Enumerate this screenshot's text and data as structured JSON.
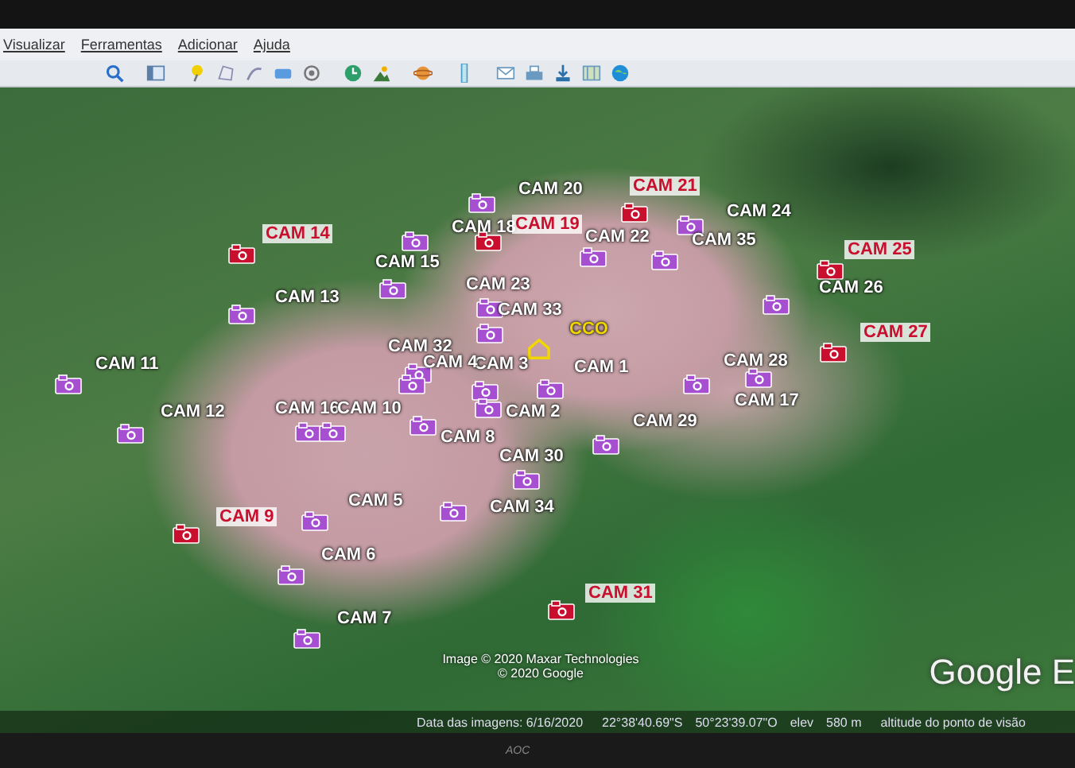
{
  "menu": [
    {
      "label": "Visualizar"
    },
    {
      "label": "Ferramentas"
    },
    {
      "label": "Adicionar"
    },
    {
      "label": "Ajuda"
    }
  ],
  "markers": [
    {
      "kind": "camera",
      "label": "CAM 20",
      "color": "#a64fd0"
    },
    {
      "kind": "camera",
      "label": "CAM 21",
      "color": "#c8102e"
    },
    {
      "kind": "camera",
      "label": "CAM 24",
      "color": "#a64fd0"
    },
    {
      "kind": "camera",
      "label": "CAM 14",
      "color": "#c8102e"
    },
    {
      "kind": "camera",
      "label": "CAM 18",
      "color": "#a64fd0"
    },
    {
      "kind": "camera",
      "label": "CAM 19",
      "color": "#c8102e"
    },
    {
      "kind": "camera",
      "label": "CAM 22",
      "color": "#a64fd0"
    },
    {
      "kind": "camera",
      "label": "CAM 35",
      "color": "#a64fd0"
    },
    {
      "kind": "camera",
      "label": "CAM 25",
      "color": "#c8102e"
    },
    {
      "kind": "camera",
      "label": "CAM 15",
      "color": "#a64fd0"
    },
    {
      "kind": "camera",
      "label": "CAM 23",
      "color": "#a64fd0"
    },
    {
      "kind": "camera",
      "label": "CAM 13",
      "color": "#a64fd0"
    },
    {
      "kind": "camera",
      "label": "CAM 26",
      "color": "#a64fd0"
    },
    {
      "kind": "camera",
      "label": "CAM 33",
      "color": "#a64fd0"
    },
    {
      "kind": "home",
      "label": "CCO",
      "color": "#f2d600"
    },
    {
      "kind": "camera",
      "label": "CAM 27",
      "color": "#c8102e"
    },
    {
      "kind": "camera",
      "label": "CAM 11",
      "color": "#a64fd0"
    },
    {
      "kind": "camera",
      "label": "CAM 32",
      "color": "#a64fd0"
    },
    {
      "kind": "camera",
      "label": "CAM 3",
      "color": "#a64fd0"
    },
    {
      "kind": "camera",
      "label": "CAM 1",
      "color": "#a64fd0"
    },
    {
      "kind": "camera",
      "label": "CAM 2",
      "color": "#a64fd0"
    },
    {
      "kind": "camera",
      "label": "CAM 28",
      "color": "#a64fd0"
    },
    {
      "kind": "camera",
      "label": "CAM 17",
      "color": "#a64fd0"
    },
    {
      "kind": "camera",
      "label": "CAM 4",
      "color": "#a64fd0"
    },
    {
      "kind": "camera",
      "label": "CAM 8",
      "color": "#a64fd0"
    },
    {
      "kind": "camera",
      "label": "CAM 12",
      "color": "#a64fd0"
    },
    {
      "kind": "camera",
      "label": "CAM 16",
      "color": "#a64fd0"
    },
    {
      "kind": "camera",
      "label": "CAM 10",
      "color": "#a64fd0"
    },
    {
      "kind": "camera",
      "label": "CAM 29",
      "color": "#a64fd0"
    },
    {
      "kind": "camera",
      "label": "CAM 30",
      "color": "#a64fd0"
    },
    {
      "kind": "camera",
      "label": "CAM 34",
      "color": "#a64fd0"
    },
    {
      "kind": "camera",
      "label": "CAM 5",
      "color": "#a64fd0"
    },
    {
      "kind": "camera",
      "label": "CAM 9",
      "color": "#c8102e"
    },
    {
      "kind": "camera",
      "label": "CAM 6",
      "color": "#a64fd0"
    },
    {
      "kind": "camera",
      "label": "CAM 7",
      "color": "#a64fd0"
    },
    {
      "kind": "camera",
      "label": "CAM 31",
      "color": "#c8102e"
    }
  ],
  "attribution": [
    "Image © 2020 Maxar Technologies",
    "© 2020 Google"
  ],
  "logo": "Google E",
  "status_bar": {
    "imagery_date": "Data das imagens: 6/16/2020",
    "latitude": "22°38'40.69\"S",
    "longitude": "50°23'39.07\"O",
    "elev_label": "elev",
    "elev_value": "580 m",
    "eye_altitude_label": "altitude do ponto de visão"
  },
  "monitor_brand": "AOC"
}
